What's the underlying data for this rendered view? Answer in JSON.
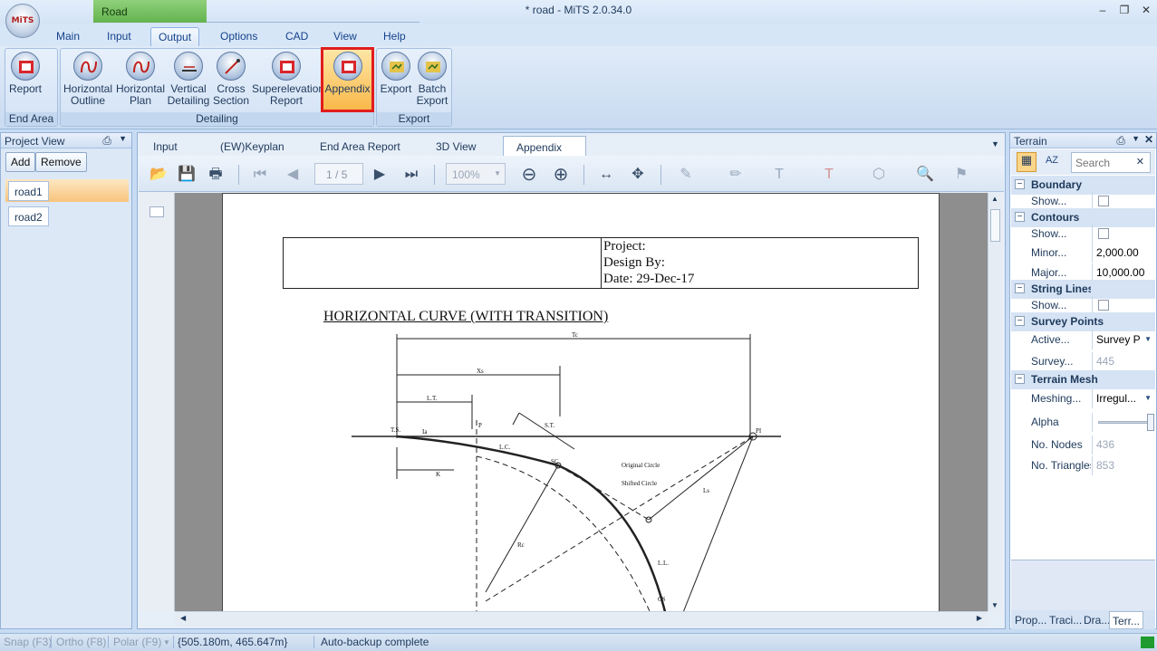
{
  "window": {
    "title": "* road - MiTS 2.0.34.0",
    "context_tab": "Road",
    "app_logo": "MiTS"
  },
  "ribbon_tabs": [
    "Main",
    "Input",
    "Output",
    "Options",
    "CAD",
    "View",
    "Help"
  ],
  "ribbon": {
    "groups": {
      "end_area": "End Area",
      "detailing": "Detailing",
      "export": "Export"
    },
    "buttons": {
      "report": [
        "Report"
      ],
      "horizontal_outline": [
        "Horizontal",
        "Outline"
      ],
      "horizontal_plan": [
        "Horizontal",
        "Plan"
      ],
      "vertical_detailing": [
        "Vertical",
        "Detailing"
      ],
      "cross_section": [
        "Cross",
        "Section"
      ],
      "superelevation_report": [
        "Superelevation",
        "Report"
      ],
      "appendix": [
        "Appendix"
      ],
      "export": [
        "Export"
      ],
      "batch_export": [
        "Batch",
        "Export"
      ]
    }
  },
  "project_view": {
    "title": "Project View",
    "add": "Add",
    "remove": "Remove",
    "items": [
      "road1",
      "road2"
    ]
  },
  "doc_tabs": [
    "Input",
    "(EW)Keyplan",
    "End Area Report",
    "3D View",
    "Appendix"
  ],
  "viewer": {
    "page_current": "1",
    "page_total": "/ 5",
    "zoom": "100%"
  },
  "document": {
    "header_lines": [
      "Project:",
      "Design By:",
      "Date: 29-Dec-17"
    ],
    "heading": "HORIZONTAL CURVE (WITH TRANSITION)",
    "labels": {
      "tc": "Tc",
      "xs": "Xs",
      "lt": "L.T.",
      "p": "P",
      "ts": "T.S.",
      "st": "S.T.",
      "ia": "Ia",
      "lc": "L.C.",
      "k": "K",
      "sc": "SC",
      "cs": "CS",
      "ps": "PI",
      "original": "Original Circle",
      "shifted": "Shifted Circle",
      "rc": "Rc",
      "ls": "Ls",
      "ll": "L.L."
    }
  },
  "terrain": {
    "title": "Terrain",
    "search_placeholder": "Search",
    "categories": {
      "boundary": "Boundary",
      "contours": "Contours",
      "string_lines": "String Lines",
      "survey_points": "Survey Points",
      "terrain_mesh": "Terrain Mesh"
    },
    "props": {
      "boundary_show": "Show...",
      "contours_show": "Show...",
      "minor": "Minor...",
      "minor_val": "2,000.00",
      "major": "Major...",
      "major_val": "10,000.00",
      "string_show": "Show...",
      "active": "Active...",
      "active_val": "Survey P",
      "survey": "Survey...",
      "survey_val": "445",
      "meshing": "Meshing...",
      "meshing_val": "Irregul...",
      "alpha": "Alpha",
      "nodes": "No. Nodes",
      "nodes_val": "436",
      "triangles": "No. Triangles",
      "triangles_val": "853"
    },
    "bottom_tabs": [
      "Prop...",
      "Traci...",
      "Dra...",
      "Terr..."
    ]
  },
  "status": {
    "snap": "Snap (F3)",
    "ortho": "Ortho (F8)",
    "polar": "Polar (F9)",
    "coords": "{505.180m, 465.647m}",
    "message": "Auto-backup complete"
  },
  "colors": {
    "accent": "#f9b84a",
    "highlight": "#e11d1d",
    "status_ok": "#1f9a2e"
  }
}
